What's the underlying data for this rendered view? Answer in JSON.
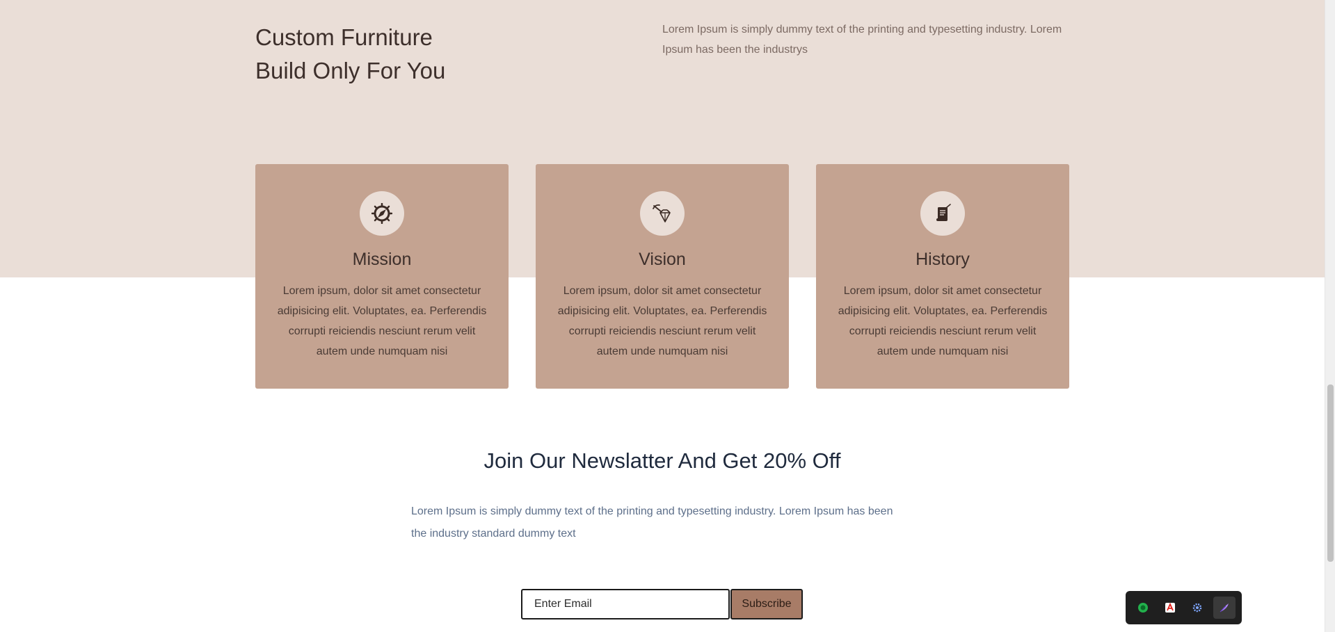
{
  "hero": {
    "title_line1": "Custom Furniture",
    "title_line2": "Build Only For You",
    "description": "Lorem Ipsum is simply dummy text of the printing and typesetting industry. Lorem Ipsum has been the industrys"
  },
  "cards": [
    {
      "icon": "compass-icon",
      "title": "Mission",
      "body": "Lorem ipsum, dolor sit amet consectetur adipisicing elit. Voluptates, ea. Perferendis corrupti reiciendis nesciunt rerum velit autem unde numquam nisi"
    },
    {
      "icon": "diamond-pickaxe-icon",
      "title": "Vision",
      "body": "Lorem ipsum, dolor sit amet consectetur adipisicing elit. Voluptates, ea. Perferendis corrupti reiciendis nesciunt rerum velit autem unde numquam nisi"
    },
    {
      "icon": "scroll-document-icon",
      "title": "History",
      "body": "Lorem ipsum, dolor sit amet consectetur adipisicing elit. Voluptates, ea. Perferendis corrupti reiciendis nesciunt rerum velit autem unde numquam nisi"
    }
  ],
  "newsletter": {
    "title": "Join Our Newslatter And Get 20% Off",
    "description": "Lorem Ipsum is simply dummy text of the printing and typesetting industry. Lorem Ipsum has been the industry standard dummy text",
    "email_placeholder": "Enter Email",
    "email_value": "",
    "subscribe_label": "Subscribe"
  },
  "taskbar_tray": {
    "items": [
      "green-app-icon",
      "pdf-app-icon",
      "settings-gear-icon",
      "feather-pen-icon"
    ]
  },
  "colors": {
    "band_background": "#eaded7",
    "card_background": "#c4a391",
    "button_background": "#a87c67",
    "heading_text": "#3d2f2b"
  }
}
